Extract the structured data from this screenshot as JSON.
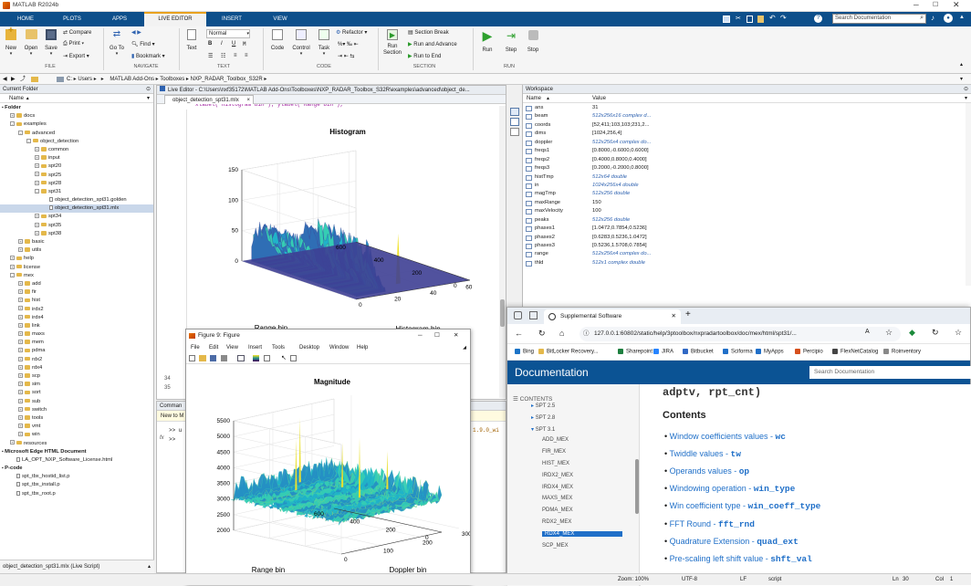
{
  "app": {
    "title": "MATLAB R2024b",
    "search_placeholder": "Search Documentation"
  },
  "tabs": [
    "HOME",
    "PLOTS",
    "APPS",
    "LIVE EDITOR",
    "INSERT",
    "VIEW"
  ],
  "ribbon": {
    "new": "New",
    "open": "Open",
    "save": "Save",
    "compare": "Compare",
    "print": "Print",
    "export": "Export",
    "file_group": "FILE",
    "goto": "Go To",
    "find": "Find",
    "bookmark": "Bookmark",
    "navigate_group": "NAVIGATE",
    "text_btn": "Text",
    "normal": "Normal",
    "text_group": "TEXT",
    "code": "Code",
    "control": "Control",
    "task": "Task",
    "refactor": "Refactor",
    "code_group": "CODE",
    "run_section": "Run Section",
    "section_break": "Section Break",
    "run_advance": "Run and Advance",
    "run_end": "Run to End",
    "section_group": "SECTION",
    "run": "Run",
    "step": "Step",
    "stop": "Stop",
    "run_group": "RUN"
  },
  "addressbar": [
    "C:",
    "Users",
    "MATLAB Add-Ons",
    "Toolboxes",
    "NXP_RADAR_Toolbox_S32R"
  ],
  "current_folder": {
    "title": "Current Folder",
    "col_name": "Name",
    "items": [
      {
        "label": "Folder",
        "level": 0,
        "bold": true
      },
      {
        "label": "docs",
        "level": 1,
        "kind": "folder",
        "exp": "+"
      },
      {
        "label": "examples",
        "level": 1,
        "kind": "folder",
        "exp": "-"
      },
      {
        "label": "advanced",
        "level": 2,
        "kind": "folder",
        "exp": "-"
      },
      {
        "label": "object_detection",
        "level": 3,
        "kind": "folder",
        "exp": "-"
      },
      {
        "label": "common",
        "level": 4,
        "kind": "folder",
        "exp": "+"
      },
      {
        "label": "input",
        "level": 4,
        "kind": "folder",
        "exp": "+"
      },
      {
        "label": "spt20",
        "level": 4,
        "kind": "folder",
        "exp": "+"
      },
      {
        "label": "spt25",
        "level": 4,
        "kind": "folder",
        "exp": "+"
      },
      {
        "label": "spt28",
        "level": 4,
        "kind": "folder",
        "exp": "+"
      },
      {
        "label": "spt31",
        "level": 4,
        "kind": "folder",
        "exp": "-"
      },
      {
        "label": "object_detection_spt31.golden",
        "level": 5,
        "kind": "file"
      },
      {
        "label": "object_detection_spt31.mlx",
        "level": 5,
        "kind": "file",
        "selected": true
      },
      {
        "label": "spt34",
        "level": 4,
        "kind": "folder",
        "exp": "+"
      },
      {
        "label": "spt35",
        "level": 4,
        "kind": "folder",
        "exp": "+"
      },
      {
        "label": "spt38",
        "level": 4,
        "kind": "folder",
        "exp": "+"
      },
      {
        "label": "basic",
        "level": 2,
        "kind": "folder",
        "exp": "+"
      },
      {
        "label": "utils",
        "level": 2,
        "kind": "folder",
        "exp": "+"
      },
      {
        "label": "help",
        "level": 1,
        "kind": "folder",
        "exp": "+"
      },
      {
        "label": "license",
        "level": 1,
        "kind": "folder",
        "exp": "+"
      },
      {
        "label": "mex",
        "level": 1,
        "kind": "folder",
        "exp": "-"
      },
      {
        "label": "add",
        "level": 2,
        "kind": "folder",
        "exp": "+"
      },
      {
        "label": "fir",
        "level": 2,
        "kind": "folder",
        "exp": "+"
      },
      {
        "label": "hist",
        "level": 2,
        "kind": "folder",
        "exp": "+"
      },
      {
        "label": "irdx2",
        "level": 2,
        "kind": "folder",
        "exp": "+"
      },
      {
        "label": "irdx4",
        "level": 2,
        "kind": "folder",
        "exp": "+"
      },
      {
        "label": "link",
        "level": 2,
        "kind": "folder",
        "exp": "+"
      },
      {
        "label": "maxs",
        "level": 2,
        "kind": "folder",
        "exp": "+"
      },
      {
        "label": "mem",
        "level": 2,
        "kind": "folder",
        "exp": "+"
      },
      {
        "label": "pdma",
        "level": 2,
        "kind": "folder",
        "exp": "+"
      },
      {
        "label": "rdx2",
        "level": 2,
        "kind": "folder",
        "exp": "+"
      },
      {
        "label": "rdx4",
        "level": 2,
        "kind": "folder",
        "exp": "+"
      },
      {
        "label": "scp",
        "level": 2,
        "kind": "folder",
        "exp": "+"
      },
      {
        "label": "sim",
        "level": 2,
        "kind": "folder",
        "exp": "+"
      },
      {
        "label": "sort",
        "level": 2,
        "kind": "folder",
        "exp": "+"
      },
      {
        "label": "sub",
        "level": 2,
        "kind": "folder",
        "exp": "+"
      },
      {
        "label": "switch",
        "level": 2,
        "kind": "folder",
        "exp": "+"
      },
      {
        "label": "tools",
        "level": 2,
        "kind": "folder",
        "exp": "+"
      },
      {
        "label": "vmt",
        "level": 2,
        "kind": "folder",
        "exp": "+"
      },
      {
        "label": "win",
        "level": 2,
        "kind": "folder",
        "exp": "+"
      },
      {
        "label": "resources",
        "level": 1,
        "kind": "folder",
        "exp": "+"
      },
      {
        "label": "Microsoft Edge HTML Document",
        "level": 0,
        "bold": true
      },
      {
        "label": "LA_OPT_NXP_Software_License.html",
        "level": 1,
        "kind": "file"
      },
      {
        "label": "P-code",
        "level": 0,
        "bold": true
      },
      {
        "label": "spt_tbx_hostid_list.p",
        "level": 1,
        "kind": "file"
      },
      {
        "label": "spt_tbx_install.p",
        "level": 1,
        "kind": "file"
      },
      {
        "label": "spt_tbx_root.p",
        "level": 1,
        "kind": "file"
      }
    ],
    "footer": "object_detection_spt31.mlx  (Live Script)"
  },
  "editor": {
    "title": "Live Editor - C:\\Users\\nxf35172\\MATLAB Add-Ons\\Toolboxes\\NXP_RADAR_Toolbox_S32R\\examples\\advanced\\object_de...",
    "tab": "object_detection_spt31.mlx",
    "line34": "34",
    "line35": "35"
  },
  "histogram": {
    "title": "Histogram",
    "xlabel": "Histogram bin",
    "ylabel": "Range bin"
  },
  "command_window": {
    "title": "Comman",
    "new_to": "New to M",
    "prompt1": ">> u",
    "prompt2": ">>",
    "fx": "fx",
    "version": "1.9.0_wi"
  },
  "workspace": {
    "title": "Workspace",
    "col_name": "Name",
    "col_value": "Value",
    "vars": [
      {
        "name": "ans",
        "value": "31",
        "italic": false
      },
      {
        "name": "beam",
        "value": "512x256x16 complex d...",
        "italic": true
      },
      {
        "name": "coords",
        "value": "[52,411;103,103;231,2...",
        "italic": false
      },
      {
        "name": "dims",
        "value": "[1024,256,4]",
        "italic": false
      },
      {
        "name": "doppler",
        "value": "512x256x4 complex do...",
        "italic": true
      },
      {
        "name": "freqs1",
        "value": "[0.8000,-0.6000,0.6000]",
        "italic": false
      },
      {
        "name": "freqs2",
        "value": "[0.4000,0.8000,0.4000]",
        "italic": false
      },
      {
        "name": "freqs3",
        "value": "[0.2000,-0.2000,0.8000]",
        "italic": false
      },
      {
        "name": "histTmp",
        "value": "512x64 double",
        "italic": true
      },
      {
        "name": "in",
        "value": "1024x256x4 double",
        "italic": true
      },
      {
        "name": "magTmp",
        "value": "512x256 double",
        "italic": true
      },
      {
        "name": "maxRange",
        "value": "150",
        "italic": false
      },
      {
        "name": "maxVelocity",
        "value": "100",
        "italic": false
      },
      {
        "name": "peaks",
        "value": "512x256 double",
        "italic": true
      },
      {
        "name": "phases1",
        "value": "[1.0472,0.7854,0.5236]",
        "italic": false
      },
      {
        "name": "phases2",
        "value": "[0.6283,0.5236,1.0472]",
        "italic": false
      },
      {
        "name": "phases3",
        "value": "[0.5236,1.5708,0.7854]",
        "italic": false
      },
      {
        "name": "range",
        "value": "512x256x4 complex do...",
        "italic": true
      },
      {
        "name": "thld",
        "value": "512x1 complex double",
        "italic": true
      }
    ]
  },
  "figure": {
    "title": "Figure 9: Figure",
    "menu": [
      "File",
      "Edit",
      "View",
      "Insert",
      "Tools",
      "Desktop",
      "Window",
      "Help"
    ],
    "plot_title": "Magnitude",
    "xlabel": "Doppler bin",
    "ylabel": "Range bin"
  },
  "browser": {
    "tab_title": "Supplemental Software",
    "url": "127.0.0.1:60802/static/help/3ptoolbox/nxpradartoolbox/doc/mex/html/spt31/...",
    "bookmarks": [
      "Bing",
      "BitLocker Recovery...",
      "Sharepoint",
      "JIRA",
      "Bitbucket",
      "Sciforma",
      "MyApps",
      "Percipio",
      "FlexNetCatalog",
      "Roinventory"
    ],
    "doc_title": "Documentation",
    "search_placeholder": "Search Documentation",
    "contents_label": "CONTENTS",
    "toc": [
      {
        "label": "SPT 2.5",
        "level": 0
      },
      {
        "label": "SPT 2.8",
        "level": 0
      },
      {
        "label": "SPT 3.1",
        "level": 0
      },
      {
        "label": "ADD_MEX",
        "level": 1
      },
      {
        "label": "FIR_MEX",
        "level": 1
      },
      {
        "label": "HIST_MEX",
        "level": 1
      },
      {
        "label": "IRDX2_MEX",
        "level": 1
      },
      {
        "label": "IRDX4_MEX",
        "level": 1
      },
      {
        "label": "MAXS_MEX",
        "level": 1
      },
      {
        "label": "PDMA_MEX",
        "level": 1
      },
      {
        "label": "RDX2_MEX",
        "level": 1
      },
      {
        "label": "RDX4_MEX",
        "level": 1,
        "selected": true
      },
      {
        "label": "SCP_MEX",
        "level": 1
      }
    ],
    "code_header": "adptv, rpt_cnt)",
    "contents_heading": "Contents",
    "contents": [
      {
        "text": "Window coefficients values - ",
        "code": "wc"
      },
      {
        "text": "Twiddle values - ",
        "code": "tw"
      },
      {
        "text": "Operands values - ",
        "code": "op"
      },
      {
        "text": "Windowing operation - ",
        "code": "win_type"
      },
      {
        "text": "Win coefficient type - ",
        "code": "win_coeff_type"
      },
      {
        "text": "FFT Round - ",
        "code": "fft_rnd"
      },
      {
        "text": "Quadrature Extension - ",
        "code": "quad_ext"
      },
      {
        "text": "Pre-scaling left shift value - ",
        "code": "shft_val"
      }
    ]
  },
  "status_bar": {
    "zoom": "Zoom: 100%",
    "encoding": "UTF-8",
    "eol": "LF",
    "type": "script",
    "ln_label": "Ln",
    "ln": "30",
    "col_label": "Col",
    "col": "1"
  },
  "chart_data": [
    {
      "type": "surface",
      "title": "Histogram",
      "xlabel": "Histogram bin",
      "ylabel": "Range bin",
      "zlabel": "",
      "x_ticks": [
        0,
        20,
        40,
        60
      ],
      "y_ticks": [
        0,
        200,
        400,
        600
      ],
      "z_ticks": [
        0,
        50,
        100,
        150
      ],
      "xlim": [
        0,
        64
      ],
      "ylim": [
        0,
        600
      ],
      "zlim": [
        0,
        150
      ]
    },
    {
      "type": "surface",
      "title": "Magnitude",
      "xlabel": "Doppler bin",
      "ylabel": "Range bin",
      "zlabel": "",
      "x_ticks": [
        0,
        100,
        200,
        300
      ],
      "y_ticks": [
        0,
        200,
        400,
        600
      ],
      "z_ticks": [
        2000,
        2500,
        3000,
        3500,
        4000,
        4500,
        5000,
        5500
      ],
      "xlim": [
        0,
        256
      ],
      "ylim": [
        0,
        600
      ],
      "zlim": [
        2000,
        5500
      ]
    }
  ]
}
